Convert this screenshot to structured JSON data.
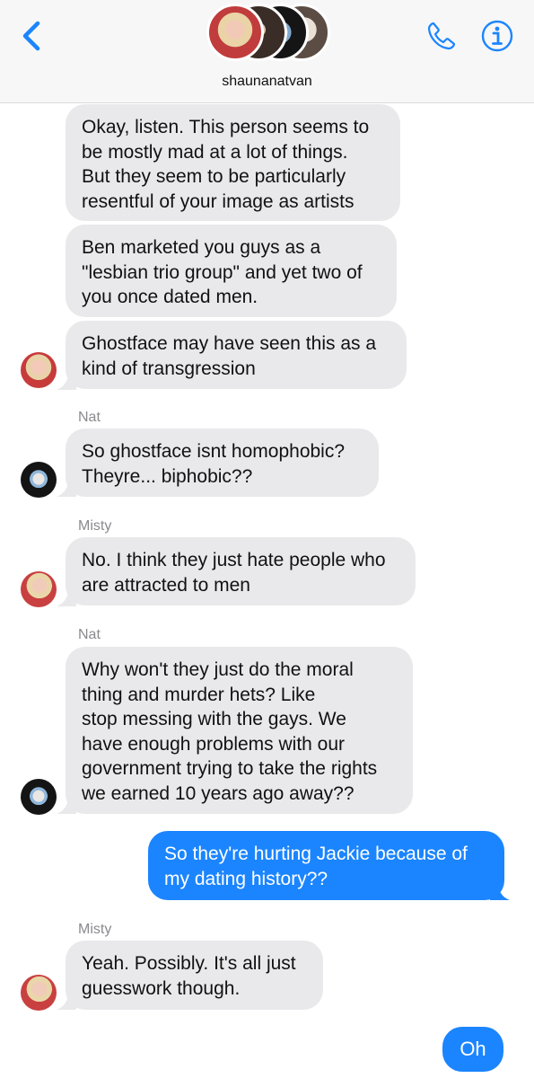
{
  "header": {
    "title": "shaunanatvan",
    "back_icon": "chevron-left-icon",
    "call_icon": "phone-icon",
    "info_icon": "info-icon",
    "accent_color": "#1b85ff"
  },
  "messages": [
    {
      "sender_label": "",
      "text": "Okay, listen. This person seems to\nbe mostly mad at a lot of things.\nBut they seem to be particularly\nresentful of your image as artists",
      "from": "shauna"
    },
    {
      "sender_label": "",
      "text": "Ben marketed you guys as a\n\"lesbian trio group\" and yet two of\nyou once dated men.",
      "from": "shauna"
    },
    {
      "sender_label": "",
      "text": "Ghostface may have seen this as a\nkind of transgression",
      "from": "shauna"
    },
    {
      "sender_label": "Nat",
      "text": "So ghostface isnt homophobic?\nTheyre... biphobic??",
      "from": "nat"
    },
    {
      "sender_label": "Misty",
      "text": "No. I think they just hate people who\nare attracted to men",
      "from": "misty"
    },
    {
      "sender_label": "Nat",
      "text": "Why won't they just do the moral\nthing and murder hets? Like\nstop messing with the gays. We\nhave enough problems with our\ngovernment trying to take the rights\nwe earned 10 years ago away??",
      "from": "nat"
    },
    {
      "sender_label": "",
      "text": "So they're hurting Jackie because of\nmy dating history??",
      "from": "me"
    },
    {
      "sender_label": "Misty",
      "text": "Yeah. Possibly. It's all just\nguesswork though.",
      "from": "misty"
    },
    {
      "sender_label": "",
      "text": "Oh",
      "from": "me"
    }
  ],
  "colors": {
    "incoming_bubble": "#e9e9eb",
    "outgoing_bubble": "#1b85ff",
    "sender_label": "#8a8a8e"
  }
}
